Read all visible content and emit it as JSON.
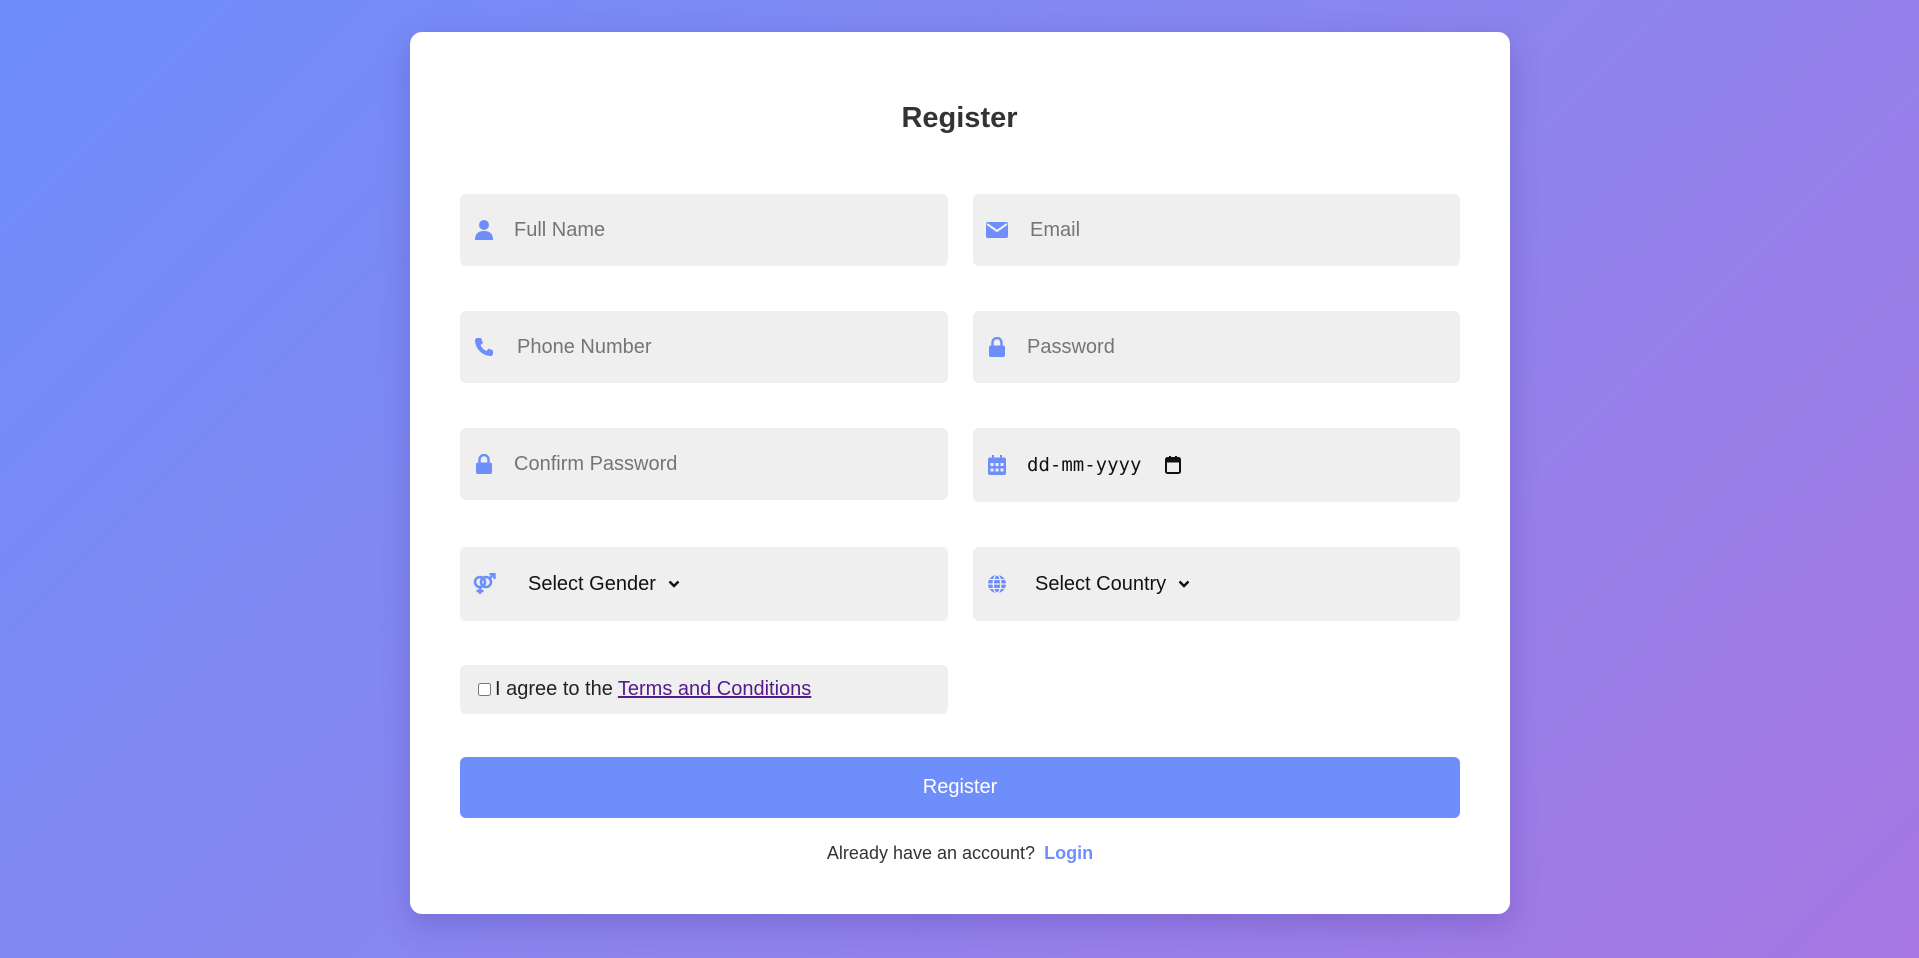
{
  "form": {
    "title": "Register",
    "full_name_placeholder": "Full Name",
    "email_placeholder": "Email",
    "phone_placeholder": "Phone Number",
    "password_placeholder": "Password",
    "confirm_password_placeholder": "Confirm Password",
    "date_placeholder": "dd-mm-yyyy",
    "gender_select": "Select Gender",
    "country_select": "Select Country",
    "terms_prefix": "I agree to the",
    "terms_link": "Terms and Conditions",
    "terms_checked": false,
    "submit_label": "Register",
    "footer_text": "Already have an account?",
    "login_link": "Login"
  },
  "icons": {
    "full_name": "user-icon",
    "email": "envelope-icon",
    "phone": "phone-icon",
    "password": "lock-icon",
    "confirm_password": "lock-icon",
    "date": "calendar-icon",
    "gender": "gender-icon",
    "country": "globe-icon"
  },
  "colors": {
    "accent": "#6e8efb",
    "gradient_end": "#a777e3",
    "field_bg": "#efefef",
    "link_visited": "#551a8b"
  }
}
